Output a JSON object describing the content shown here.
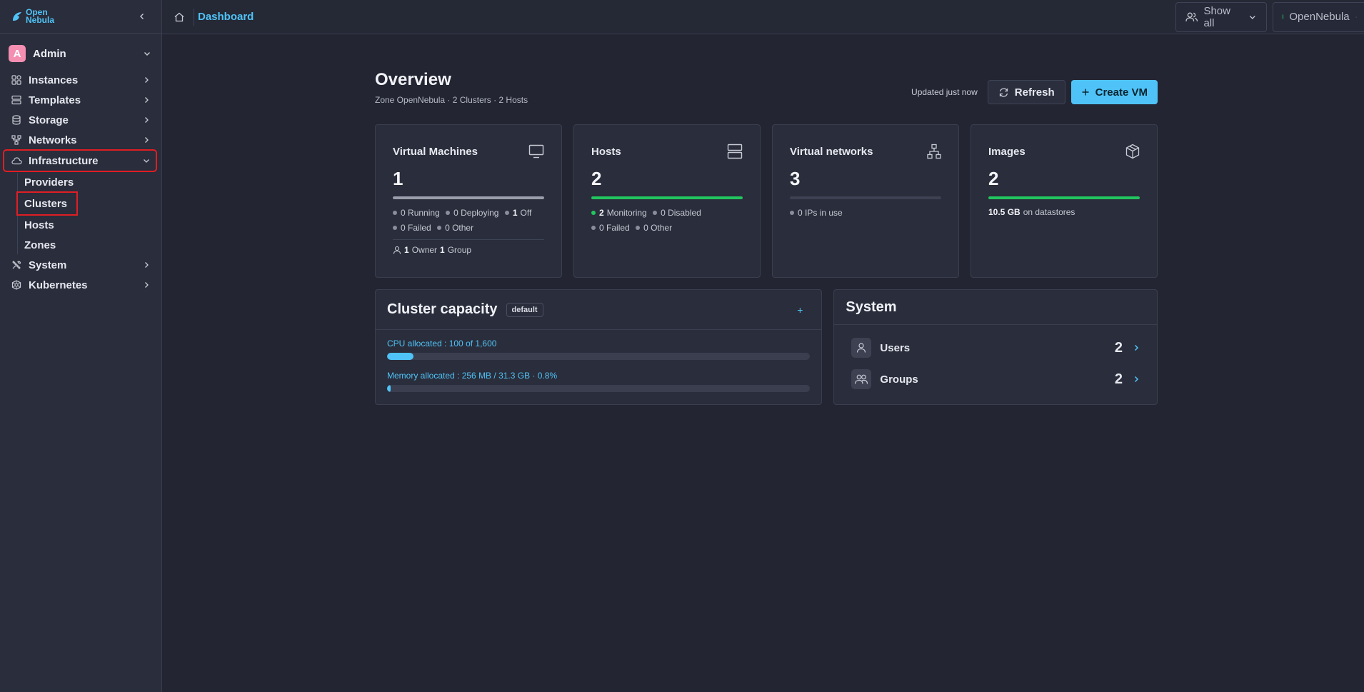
{
  "colors": {
    "accent": "#4fc3f7",
    "success": "#22c55e",
    "highlight_box": "#e01e24",
    "avatar": "#f48fb1"
  },
  "logo": {
    "line1": "Open",
    "line2": "Nebula"
  },
  "user": {
    "initial": "A",
    "name": "Admin"
  },
  "sidebar": {
    "items": [
      {
        "label": "Instances",
        "icon": "instances-icon"
      },
      {
        "label": "Templates",
        "icon": "templates-icon"
      },
      {
        "label": "Storage",
        "icon": "storage-icon"
      },
      {
        "label": "Networks",
        "icon": "networks-icon"
      },
      {
        "label": "Infrastructure",
        "icon": "cloud-icon",
        "expanded": true
      },
      {
        "label": "System",
        "icon": "tools-icon"
      },
      {
        "label": "Kubernetes",
        "icon": "kubernetes-icon"
      }
    ],
    "infrastructure_sub": [
      "Providers",
      "Clusters",
      "Hosts",
      "Zones"
    ]
  },
  "topbar": {
    "breadcrumb": "Dashboard",
    "show_all": "Show all",
    "zone": "OpenNebula"
  },
  "overview": {
    "title": "Overview",
    "subtitle": "Zone OpenNebula · 2 Clusters · 2 Hosts",
    "updated": "Updated just now",
    "refresh_label": "Refresh",
    "create_label": "Create VM"
  },
  "cards": {
    "vms": {
      "title": "Virtual Machines",
      "count": "1",
      "bar_fraction": 1.0,
      "bar_color": "#9a9eab",
      "running": "0",
      "running_label": "Running",
      "deploying": "0",
      "deploying_label": "Deploying",
      "off": "1",
      "off_label": "Off",
      "failed": "0",
      "failed_label": "Failed",
      "other": "0",
      "other_label": "Other",
      "owner": "1",
      "owner_label": "Owner",
      "group": "1",
      "group_label": "Group"
    },
    "hosts": {
      "title": "Hosts",
      "count": "2",
      "bar_fraction": 1.0,
      "bar_color": "#22c55e",
      "monitoring": "2",
      "monitoring_label": "Monitoring",
      "disabled": "0",
      "disabled_label": "Disabled",
      "failed": "0",
      "failed_label": "Failed",
      "other": "0",
      "other_label": "Other"
    },
    "vnets": {
      "title": "Virtual networks",
      "count": "3",
      "bar_fraction": 0.0,
      "ips": "0",
      "ips_label": "IPs in use"
    },
    "images": {
      "title": "Images",
      "count": "2",
      "bar_fraction": 1.0,
      "bar_color": "#22c55e",
      "size": "10.5 GB",
      "size_label": "on datastores"
    }
  },
  "capacity": {
    "title": "Cluster capacity",
    "tag": "default",
    "add": "+",
    "cpu_label": "CPU allocated : 100 of 1,600",
    "cpu_fraction": 0.0625,
    "mem_label": "Memory allocated : 256 MB / 31.3 GB · 0.8%",
    "mem_fraction": 0.008
  },
  "system": {
    "title": "System",
    "rows": [
      {
        "label": "Users",
        "value": "2"
      },
      {
        "label": "Groups",
        "value": "2"
      }
    ]
  }
}
